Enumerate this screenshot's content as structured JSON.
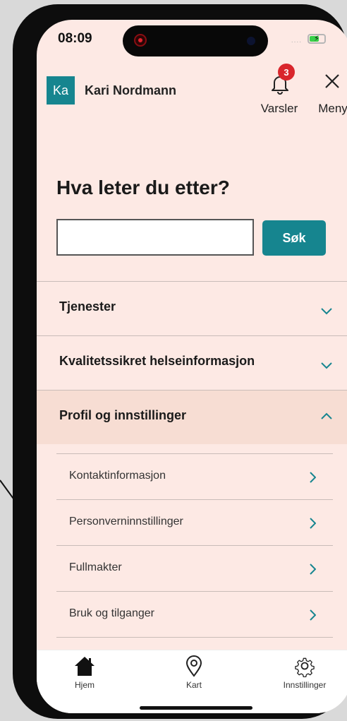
{
  "status_bar": {
    "time": "08:09",
    "signal": "....",
    "battery_level": 0.6
  },
  "header": {
    "avatar_initials": "Ka",
    "user_name": "Kari Nordmann",
    "notifications_label": "Varsler",
    "notifications_count": "3",
    "menu_label": "Meny"
  },
  "search": {
    "heading": "Hva leter du etter?",
    "placeholder": "",
    "button_label": "Søk"
  },
  "accordion": {
    "items": [
      {
        "label": "Tjenester",
        "expanded": false
      },
      {
        "label": "Kvalitetssikret helseinformasjon",
        "expanded": false
      },
      {
        "label": "Profil og innstillinger",
        "expanded": true
      }
    ],
    "sub_items": [
      {
        "label": "Kontaktinformasjon"
      },
      {
        "label": "Personverninnstillinger"
      },
      {
        "label": "Fullmakter"
      },
      {
        "label": "Bruk og tilganger"
      }
    ]
  },
  "bottom_nav": [
    {
      "label": "Hjem",
      "icon": "home-icon"
    },
    {
      "label": "Kart",
      "icon": "map-pin-icon"
    },
    {
      "label": "Innstillinger",
      "icon": "gear-icon"
    }
  ],
  "colors": {
    "accent": "#16858f",
    "page_bg": "#fde9e4",
    "badge": "#d9262c",
    "expanded_row": "#f7ddd3"
  }
}
